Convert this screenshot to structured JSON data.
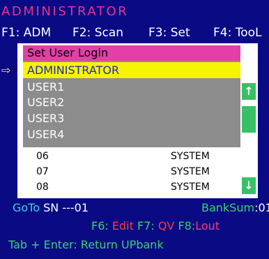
{
  "screen_title": "ADMINISTRATOR",
  "function_keys": [
    {
      "label": "F1: ADM"
    },
    {
      "label": "F2: Scan"
    },
    {
      "label": "F3: Set"
    },
    {
      "label": "F4: TooL"
    }
  ],
  "popup": {
    "heading": "Set User Login",
    "selected": "ADMINISTRATOR",
    "items": [
      "USER1",
      "USER2",
      "USER3",
      "USER4"
    ]
  },
  "list_rows": [
    {
      "num": "06",
      "type": "SYSTEM"
    },
    {
      "num": "07",
      "type": "SYSTEM"
    },
    {
      "num": "08",
      "type": "SYSTEM"
    }
  ],
  "status": {
    "goto_label": "GoTo",
    "sn_label": "SN",
    "sn_value": "---01",
    "banksum_label": "BankSum",
    "banksum_value": ":01",
    "f6_key": "F6:",
    "f6_action": "Edit",
    "f7_key": "F7:",
    "f7_action": "QV",
    "f8_key": "F8:",
    "f8_action": "Lout",
    "hint": "Tab + Enter: Return UPbank"
  },
  "icons": {
    "pointer": "pointer-arrow-icon",
    "up": "scroll-up-icon",
    "down": "scroll-down-icon"
  }
}
